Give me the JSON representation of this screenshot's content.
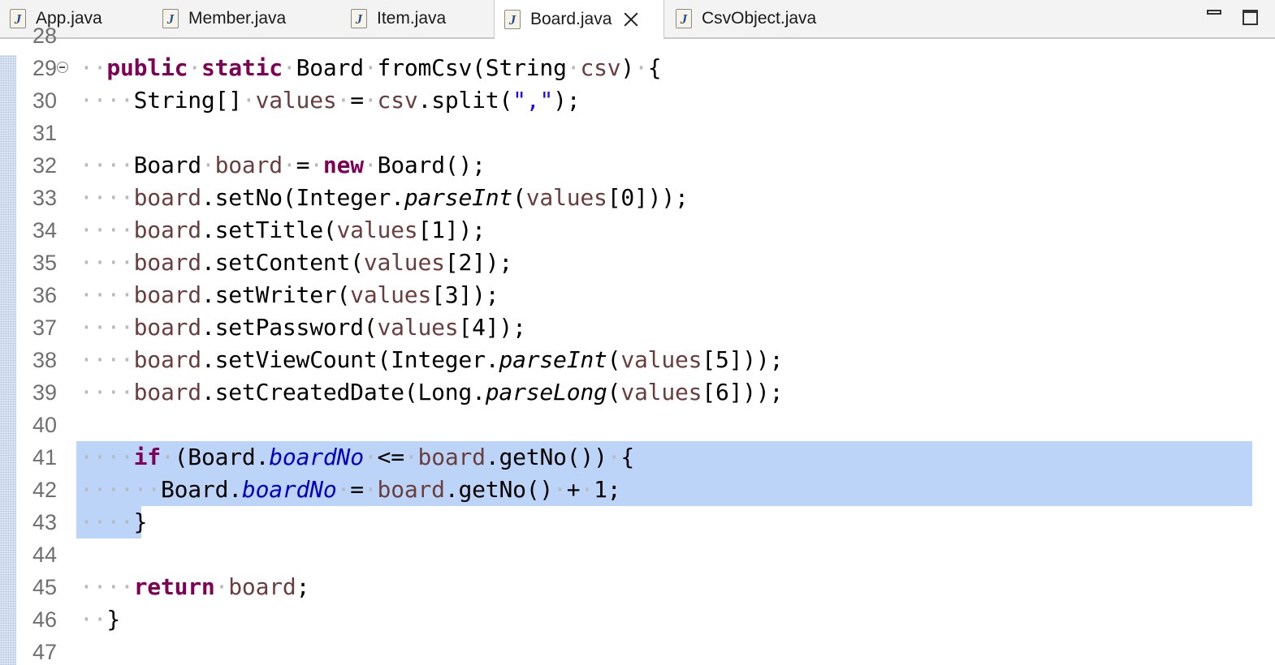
{
  "tabs": [
    {
      "label": "App.java",
      "icon": "java-file-icon",
      "active": false
    },
    {
      "label": "Member.java",
      "icon": "java-file-icon",
      "active": false
    },
    {
      "label": "Item.java",
      "icon": "java-file-icon",
      "active": false
    },
    {
      "label": "Board.java",
      "icon": "java-file-icon",
      "active": true
    },
    {
      "label": "CsvObject.java",
      "icon": "java-file-icon",
      "active": false
    }
  ],
  "window_controls": {
    "minimize": "minimize-icon",
    "maximize": "maximize-icon"
  },
  "colors": {
    "keyword": "#7f0055",
    "local_variable": "#6a3e3e",
    "string": "#2a00ff",
    "static_field": "#0000c0",
    "selection": "#bcd4f7",
    "line_number": "#6f6f6f",
    "whitespace_marker": "#b9b9b9"
  },
  "editor": {
    "lines": [
      {
        "no": "28",
        "partial": true,
        "tokens": []
      },
      {
        "no": "29",
        "fold": true,
        "tokens": [
          [
            "ws",
            "··"
          ],
          [
            "kw",
            "public"
          ],
          [
            "ws",
            "·"
          ],
          [
            "kw",
            "static"
          ],
          [
            "ws",
            "·"
          ],
          [
            "ty",
            "Board"
          ],
          [
            "ws",
            "·"
          ],
          [
            "pl",
            "fromCsv(String"
          ],
          [
            "ws",
            "·"
          ],
          [
            "var",
            "csv"
          ],
          [
            "pl",
            ")"
          ],
          [
            "ws",
            "·"
          ],
          [
            "pl",
            "{"
          ]
        ]
      },
      {
        "no": "30",
        "tokens": [
          [
            "ws",
            "····"
          ],
          [
            "pl",
            "String[]"
          ],
          [
            "ws",
            "·"
          ],
          [
            "var",
            "values"
          ],
          [
            "ws",
            "·"
          ],
          [
            "pl",
            "="
          ],
          [
            "ws",
            "·"
          ],
          [
            "var",
            "csv"
          ],
          [
            "pl",
            ".split("
          ],
          [
            "str",
            "\",\""
          ],
          [
            "pl",
            ");"
          ]
        ]
      },
      {
        "no": "31",
        "tokens": []
      },
      {
        "no": "32",
        "tokens": [
          [
            "ws",
            "····"
          ],
          [
            "pl",
            "Board"
          ],
          [
            "ws",
            "·"
          ],
          [
            "var",
            "board"
          ],
          [
            "ws",
            "·"
          ],
          [
            "pl",
            "="
          ],
          [
            "ws",
            "·"
          ],
          [
            "kw",
            "new"
          ],
          [
            "ws",
            "·"
          ],
          [
            "pl",
            "Board();"
          ]
        ]
      },
      {
        "no": "33",
        "tokens": [
          [
            "ws",
            "····"
          ],
          [
            "var",
            "board"
          ],
          [
            "pl",
            ".setNo(Integer."
          ],
          [
            "st",
            "parseInt"
          ],
          [
            "pl",
            "("
          ],
          [
            "var",
            "values"
          ],
          [
            "pl",
            "[0]));"
          ]
        ]
      },
      {
        "no": "34",
        "tokens": [
          [
            "ws",
            "····"
          ],
          [
            "var",
            "board"
          ],
          [
            "pl",
            ".setTitle("
          ],
          [
            "var",
            "values"
          ],
          [
            "pl",
            "[1]);"
          ]
        ]
      },
      {
        "no": "35",
        "tokens": [
          [
            "ws",
            "····"
          ],
          [
            "var",
            "board"
          ],
          [
            "pl",
            ".setContent("
          ],
          [
            "var",
            "values"
          ],
          [
            "pl",
            "[2]);"
          ]
        ]
      },
      {
        "no": "36",
        "tokens": [
          [
            "ws",
            "····"
          ],
          [
            "var",
            "board"
          ],
          [
            "pl",
            ".setWriter("
          ],
          [
            "var",
            "values"
          ],
          [
            "pl",
            "[3]);"
          ]
        ]
      },
      {
        "no": "37",
        "tokens": [
          [
            "ws",
            "····"
          ],
          [
            "var",
            "board"
          ],
          [
            "pl",
            ".setPassword("
          ],
          [
            "var",
            "values"
          ],
          [
            "pl",
            "[4]);"
          ]
        ]
      },
      {
        "no": "38",
        "tokens": [
          [
            "ws",
            "····"
          ],
          [
            "var",
            "board"
          ],
          [
            "pl",
            ".setViewCount(Integer."
          ],
          [
            "st",
            "parseInt"
          ],
          [
            "pl",
            "("
          ],
          [
            "var",
            "values"
          ],
          [
            "pl",
            "[5]));"
          ]
        ]
      },
      {
        "no": "39",
        "tokens": [
          [
            "ws",
            "····"
          ],
          [
            "var",
            "board"
          ],
          [
            "pl",
            ".setCreatedDate(Long."
          ],
          [
            "st",
            "parseLong"
          ],
          [
            "pl",
            "("
          ],
          [
            "var",
            "values"
          ],
          [
            "pl",
            "[6]));"
          ]
        ]
      },
      {
        "no": "40",
        "tokens": []
      },
      {
        "no": "41",
        "selected": "full",
        "tokens": [
          [
            "ws",
            "····"
          ],
          [
            "kw",
            "if"
          ],
          [
            "ws",
            "·"
          ],
          [
            "pl",
            "(Board."
          ],
          [
            "fld",
            "boardNo"
          ],
          [
            "ws",
            "·"
          ],
          [
            "pl",
            "<="
          ],
          [
            "ws",
            "·"
          ],
          [
            "var",
            "board"
          ],
          [
            "pl",
            ".getNo())"
          ],
          [
            "ws",
            "·"
          ],
          [
            "pl",
            "{"
          ]
        ]
      },
      {
        "no": "42",
        "selected": "full",
        "tokens": [
          [
            "ws",
            "······"
          ],
          [
            "pl",
            "Board."
          ],
          [
            "fld",
            "boardNo"
          ],
          [
            "ws",
            "·"
          ],
          [
            "pl",
            "="
          ],
          [
            "ws",
            "·"
          ],
          [
            "var",
            "board"
          ],
          [
            "pl",
            ".getNo()"
          ],
          [
            "ws",
            "·"
          ],
          [
            "pl",
            "+"
          ],
          [
            "ws",
            "·"
          ],
          [
            "pl",
            "1;"
          ]
        ]
      },
      {
        "no": "43",
        "selected": "partial",
        "tokens": [
          [
            "ws",
            "····"
          ],
          [
            "pl",
            "}"
          ]
        ]
      },
      {
        "no": "44",
        "tokens": []
      },
      {
        "no": "45",
        "tokens": [
          [
            "ws",
            "····"
          ],
          [
            "kw",
            "return"
          ],
          [
            "ws",
            "·"
          ],
          [
            "var",
            "board"
          ],
          [
            "pl",
            ";"
          ]
        ]
      },
      {
        "no": "46",
        "tokens": [
          [
            "ws",
            "··"
          ],
          [
            "pl",
            "}"
          ]
        ]
      },
      {
        "no": "47",
        "tokens": []
      }
    ]
  }
}
